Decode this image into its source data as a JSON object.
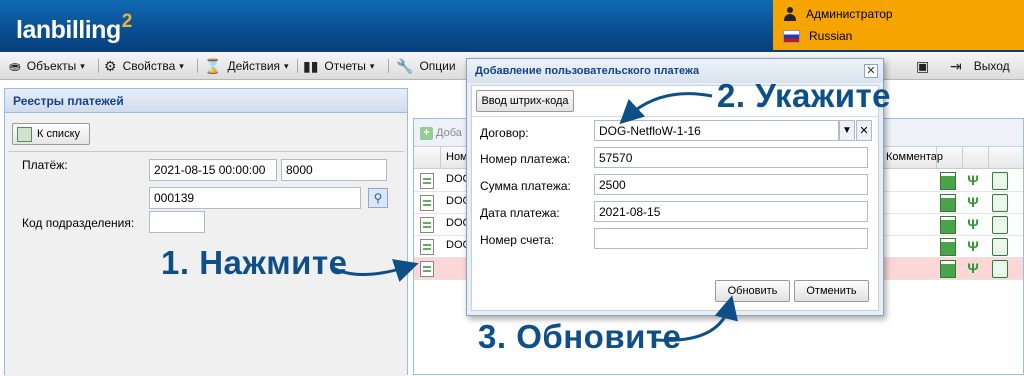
{
  "header": {
    "logo_text": "lanbilling",
    "logo_sup": "2",
    "user_name": "Администратор",
    "language": "Russian",
    "brand_color": "#0a4f94",
    "accent_color": "#f6a500"
  },
  "menu": {
    "items": [
      {
        "label": "Объекты",
        "icon": "car-icon"
      },
      {
        "label": "Свойства",
        "icon": "gear-icon"
      },
      {
        "label": "Действия",
        "icon": "hourglass-icon"
      },
      {
        "label": "Отчеты",
        "icon": "bar-chart-icon"
      },
      {
        "label": "Опции",
        "icon": "wrench-icon"
      }
    ],
    "exit_label": "Выход",
    "save_icon": "save-icon",
    "exit_icon": "exit-icon"
  },
  "left_panel": {
    "title": "Реестры платежей",
    "back_button": "К списку",
    "payment_label": "Платёж:",
    "payment_datetime": "2021-08-15 00:00:00",
    "payment_amount": "8000",
    "payment_code": "000139",
    "division_label": "Код подразделения:",
    "division_value": ""
  },
  "grid": {
    "add_label": "Доба",
    "col_name": "Ном",
    "col_comment": "Комментар",
    "rows": [
      {
        "text": "DOG"
      },
      {
        "text": "DOG"
      },
      {
        "text": "DOG"
      },
      {
        "text": "DOG"
      },
      {
        "text": ""
      }
    ],
    "highlight_color": "#fcd7d7"
  },
  "dialog": {
    "title": "Добавление пользовательского платежа",
    "barcode_button": "Ввод штрих-кода",
    "contract_label": "Договор:",
    "contract_value": "DOG-NetfloW-1-16",
    "payment_number_label": "Номер платежа:",
    "payment_number_value": "57570",
    "amount_label": "Сумма платежа:",
    "amount_value": "2500",
    "date_label": "Дата платежа:",
    "date_value": "2021-08-15",
    "account_label": "Номер счета:",
    "account_value": "",
    "update_button": "Обновить",
    "cancel_button": "Отменить"
  },
  "annotations": {
    "step1": "1. Нажмите",
    "step2": "2. Укажите",
    "step3": "3. Обновите",
    "color": "#0d4f86"
  }
}
